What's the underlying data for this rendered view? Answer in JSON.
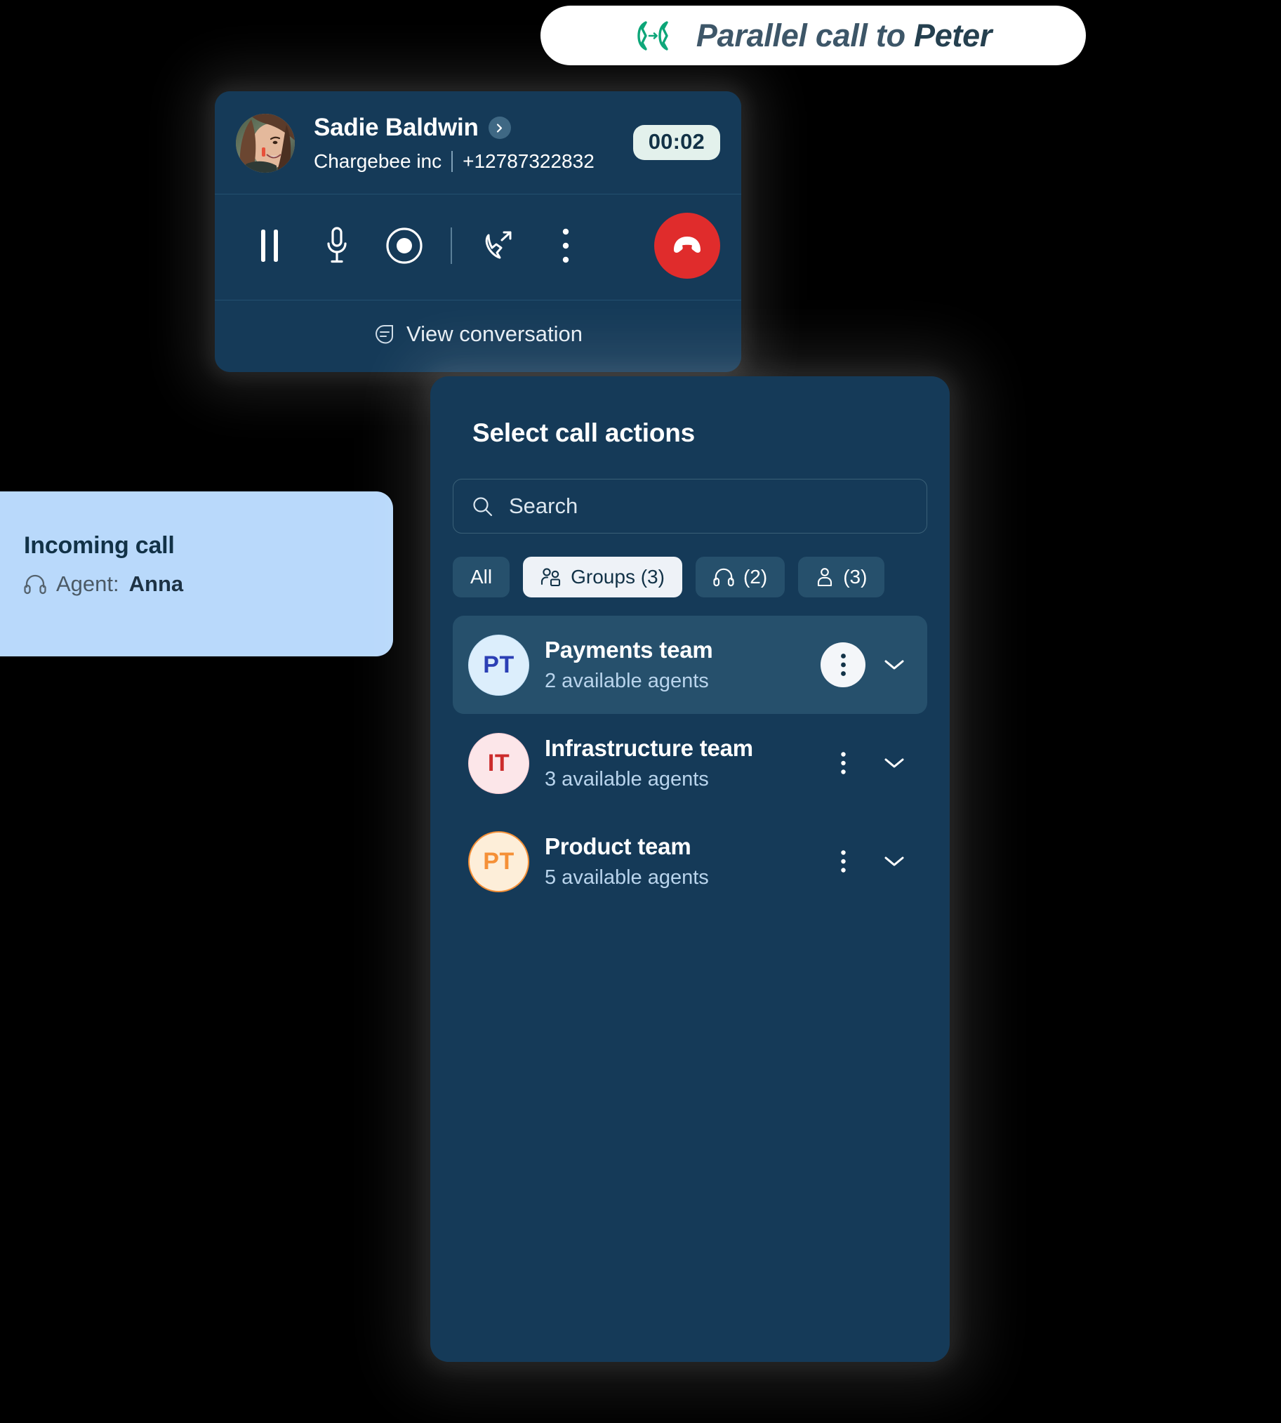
{
  "banner": {
    "icon": "parallel-call-icon",
    "text_prefix": "Parallel call to ",
    "target_name": "Peter",
    "icon_color": "#0ca678",
    "text_color": "#3d5668"
  },
  "call_card": {
    "contact_name": "Sadie Baldwin",
    "expand_icon": "chevron-right-icon",
    "company": "Chargebee inc",
    "phone": "+12787322832",
    "timer": "00:02",
    "timer_bg": "#e3f1ec",
    "controls": [
      {
        "name": "pause-icon",
        "label": "Pause"
      },
      {
        "name": "microphone-icon",
        "label": "Mute"
      },
      {
        "name": "record-icon",
        "label": "Record"
      },
      {
        "name": "call-transfer-icon",
        "label": "Transfer"
      },
      {
        "name": "more-options-icon",
        "label": "More"
      }
    ],
    "end_call": {
      "icon": "end-call-icon",
      "label": "End call",
      "color": "#e02c2c"
    },
    "footer": {
      "icon": "conversation-icon",
      "label": "View conversation"
    }
  },
  "incoming": {
    "title": "Incoming call",
    "icon": "headset-icon",
    "agent_prefix": "Agent: ",
    "agent_name": "Anna",
    "bg": "#b9d9fb"
  },
  "actions_panel": {
    "title": "Select call actions",
    "search": {
      "icon": "search-icon",
      "placeholder": "Search",
      "value": ""
    },
    "filters": [
      {
        "label": "All",
        "icon": null,
        "active": false
      },
      {
        "label": "Groups (3)",
        "icon": "group-icon",
        "active": true
      },
      {
        "label": "(2)",
        "icon": "headset-icon",
        "active": false
      },
      {
        "label": "(3)",
        "icon": "person-icon",
        "active": false
      }
    ],
    "teams": [
      {
        "initials": "PT",
        "name": "Payments team",
        "availability": "2 available agents",
        "avatar_bg": "#dceefc",
        "avatar_fg": "#2b3fb5",
        "avatar_border": "#c9e4f8",
        "selected": true,
        "kebab_icon": "more-options-icon",
        "expand_icon": "chevron-down-icon"
      },
      {
        "initials": "IT",
        "name": "Infrastructure team",
        "availability": "3 available agents",
        "avatar_bg": "#fce6e9",
        "avatar_fg": "#cc2b2b",
        "avatar_border": "#f9cdd4",
        "selected": false,
        "kebab_icon": "more-options-icon",
        "expand_icon": "chevron-down-icon"
      },
      {
        "initials": "PT",
        "name": "Product team",
        "availability": "5 available agents",
        "avatar_bg": "#fdeed9",
        "avatar_fg": "#f59037",
        "avatar_border": "#f59037",
        "selected": false,
        "kebab_icon": "more-options-icon",
        "expand_icon": "chevron-down-icon"
      }
    ]
  }
}
